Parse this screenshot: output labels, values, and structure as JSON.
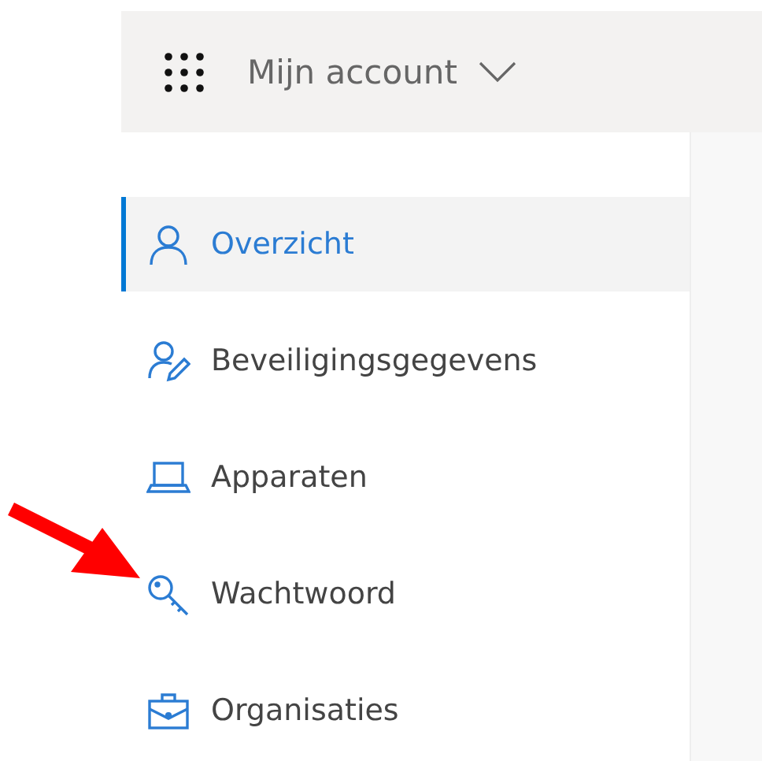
{
  "header": {
    "title": "Mijn account"
  },
  "sidebar": {
    "items": [
      {
        "label": "Overzicht",
        "kind": "person",
        "selected": true,
        "marked": false
      },
      {
        "label": "Beveiligingsgegevens",
        "kind": "person-edit",
        "selected": false,
        "marked": false
      },
      {
        "label": "Apparaten",
        "kind": "laptop",
        "selected": false,
        "marked": false
      },
      {
        "label": "Wachtwoord",
        "kind": "key",
        "selected": false,
        "marked": true
      },
      {
        "label": "Organisaties",
        "kind": "briefcase",
        "selected": false,
        "marked": false
      }
    ]
  }
}
